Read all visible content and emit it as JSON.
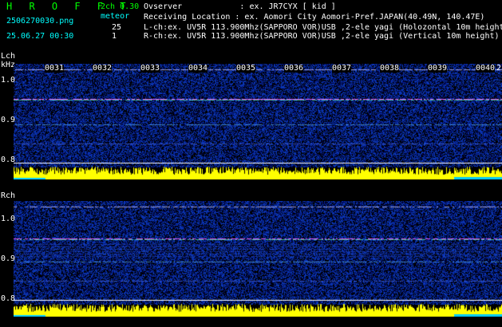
{
  "header": {
    "app_title": "H R O F F T",
    "mode": "2ch 0.30",
    "mode_sub": "meteor",
    "filename": "2506270030.png",
    "datetime": "25.06.27 00:30",
    "count_l": "25",
    "count_r": "1",
    "observer_line": "Ovserver            : ex. JR7CYX [ kid ]",
    "location_line": "Receiving Location : ex. Aomori City Aomori-Pref.JAPAN(40.49N, 140.47E)",
    "lch_line": "L-ch:ex. UV5R 113.900Mhz(SAPPORO VOR)USB ,2-ele yagi (Holozontal 10m height)",
    "rch_line": "R-ch:ex. UV5R 113.900Mhz(SAPPORO VOR)USB ,2-ele yagi (Vertical 10m height)"
  },
  "panels": {
    "left": {
      "label": "Lch",
      "unit": "kHz",
      "y_ticks": [
        "1.0",
        "0.9",
        "0.8"
      ]
    },
    "right": {
      "label": "Rch",
      "y_ticks": [
        "1.0",
        "0.9",
        "0.8"
      ]
    }
  },
  "minute_marks": [
    "0031",
    "0032",
    "0033",
    "0034",
    "0035",
    "0036",
    "0037",
    "0038",
    "0039",
    "0040"
  ],
  "trailing_mark": "2",
  "colors": {
    "background": "#000000",
    "noise_blue": "#1a2fa0",
    "level_bar": "#ffff00",
    "guide": "#ffffff"
  }
}
